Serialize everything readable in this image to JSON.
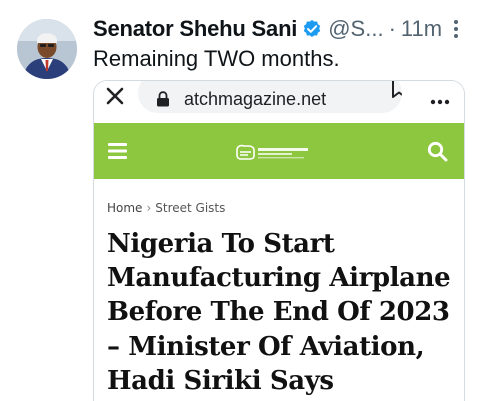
{
  "tweet": {
    "author_name": "Senator Shehu Sani",
    "handle": "@S...",
    "separator": "·",
    "time": "11m",
    "text": "Remaining TWO months."
  },
  "card": {
    "browser": {
      "url": "atchmagazine.net"
    },
    "site": {
      "header_color": "#8dc63f",
      "logo_text": "CelebrityWatch Magazine"
    },
    "breadcrumb": {
      "home": "Home",
      "separator": "›",
      "current": "Street Gists"
    },
    "headline": "Nigeria To Start Manufacturing Airplane Before The End Of 2023 – Minister Of Aviation, Hadi Siriki Says"
  },
  "icons": {
    "verified": "verified-badge-icon",
    "more": "more-vertical-icon",
    "close": "close-icon",
    "lock": "lock-icon",
    "bookmark": "bookmark-icon",
    "share": "share-icon",
    "overflow": "more-horizontal-icon",
    "menu": "hamburger-icon",
    "search": "search-icon"
  },
  "colors": {
    "verified_blue": "#1d9bf0",
    "text_secondary": "#536471"
  }
}
